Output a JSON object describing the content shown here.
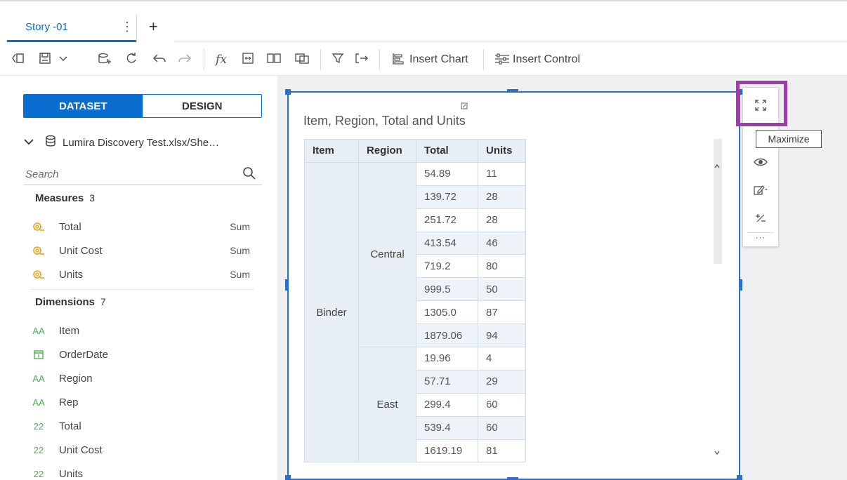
{
  "tab": {
    "label": "Story -01",
    "menu": "⋮",
    "add": "+"
  },
  "toolbar": {
    "insert_chart": "Insert Chart",
    "insert_control": "Insert Control",
    "fx": "fx"
  },
  "left_panel": {
    "tabs": {
      "dataset": "DATASET",
      "design": "DESIGN"
    },
    "dataset_name": "Lumira Discovery Test.xlsx/She…",
    "search": {
      "placeholder": "Search"
    },
    "measures": {
      "title": "Measures",
      "count": "3",
      "items": [
        {
          "label": "Total",
          "agg": "Sum"
        },
        {
          "label": "Unit Cost",
          "agg": "Sum"
        },
        {
          "label": "Units",
          "agg": "Sum"
        }
      ]
    },
    "dimensions": {
      "title": "Dimensions",
      "count": "7",
      "items": [
        {
          "label": "Item",
          "type": "AA"
        },
        {
          "label": "OrderDate",
          "type": "date"
        },
        {
          "label": "Region",
          "type": "AA"
        },
        {
          "label": "Rep",
          "type": "AA"
        },
        {
          "label": "Total",
          "type": "22"
        },
        {
          "label": "Unit Cost",
          "type": "22"
        },
        {
          "label": "Units",
          "type": "22"
        }
      ]
    }
  },
  "widget": {
    "title": "Item, Region, Total and Units",
    "table": {
      "headers": [
        "Item",
        "Region",
        "Total",
        "Units"
      ],
      "item": "Binder",
      "groups": [
        {
          "region": "Central",
          "rows": [
            [
              "54.89",
              "11"
            ],
            [
              "139.72",
              "28"
            ],
            [
              "251.72",
              "28"
            ],
            [
              "413.54",
              "46"
            ],
            [
              "719.2",
              "80"
            ],
            [
              "999.5",
              "50"
            ],
            [
              "1305.0",
              "87"
            ],
            [
              "1879.06",
              "94"
            ]
          ]
        },
        {
          "region": "East",
          "rows": [
            [
              "19.96",
              "4"
            ],
            [
              "57.71",
              "29"
            ],
            [
              "299.4",
              "60"
            ],
            [
              "539.4",
              "60"
            ],
            [
              "1619.19",
              "81"
            ]
          ]
        }
      ]
    }
  },
  "side_menu": {
    "tooltip": "Maximize",
    "more": "···"
  },
  "colors": {
    "accent": "#0a6ed1",
    "highlight": "#9b3fa8",
    "measure_icon": "#e8a317",
    "dimension_icon": "#4caf50"
  }
}
